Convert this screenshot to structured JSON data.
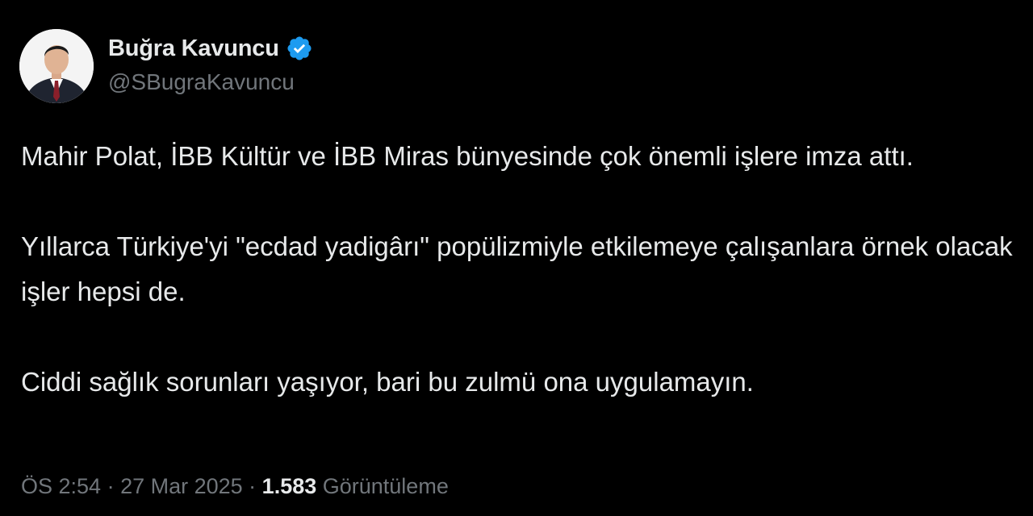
{
  "author": {
    "display_name": "Buğra Kavuncu",
    "handle": "@SBugraKavuncu",
    "verified_color": "#1d9bf0"
  },
  "tweet": {
    "paragraphs": [
      "Mahir Polat, İBB Kültür ve İBB Miras bünyesinde çok önemli işlere imza attı.",
      "Yıllarca Türkiye'yi \"ecdad yadigârı\" popülizmiyle etkilemeye çalışanlara örnek olacak işler hepsi de.",
      "Ciddi sağlık sorunları yaşıyor, bari bu zulmü ona uygulamayın."
    ]
  },
  "meta": {
    "time": "ÖS 2:54",
    "separator1": " · ",
    "date": "27 Mar 2025",
    "separator2": " · ",
    "views_count": "1.583",
    "views_label": " Görüntüleme"
  },
  "icons": {
    "avatar": "avatar-photo",
    "verified": "verified-badge-icon"
  }
}
